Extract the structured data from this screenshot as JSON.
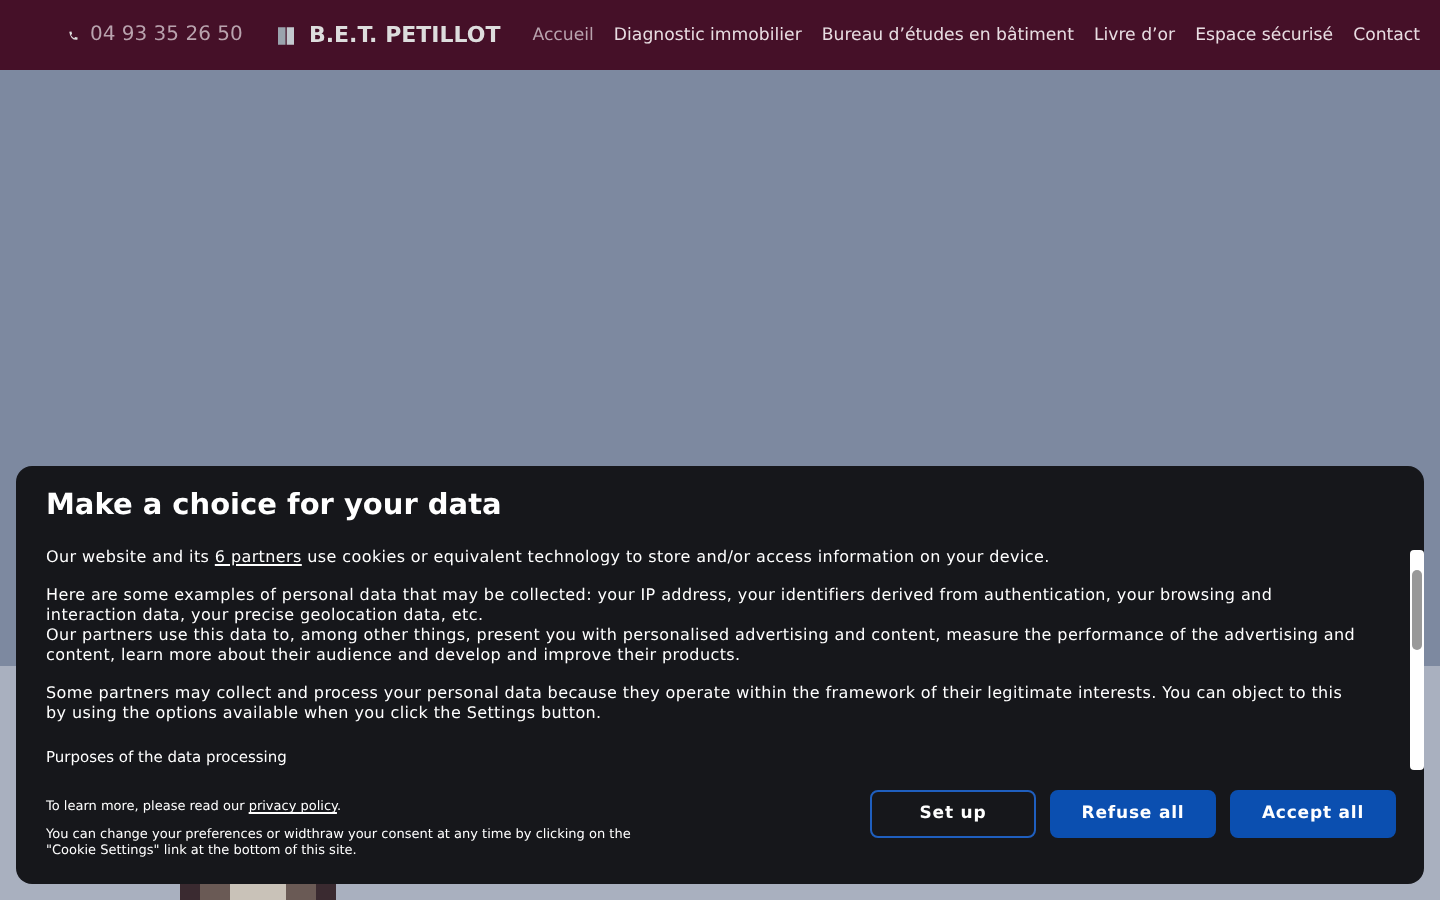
{
  "header": {
    "phone": "04 93 35 26 50",
    "brand": "B.E.T. PETILLOT",
    "nav": [
      {
        "label": "Accueil",
        "selected": true
      },
      {
        "label": "Diagnostic immobilier",
        "selected": false
      },
      {
        "label": "Bureau d’études en bâtiment",
        "selected": false
      },
      {
        "label": "Livre d’or",
        "selected": false
      },
      {
        "label": "Espace sécurisé",
        "selected": false
      },
      {
        "label": "Contact",
        "selected": false
      }
    ]
  },
  "consent": {
    "title": "Make a choice for your data",
    "intro_before": "Our website and its",
    "partners_link": "6 partners",
    "intro_after": "use cookies or equivalent technology to store and/or access information on your device.",
    "paragraphs": [
      "Here are some examples of personal data that may be collected: your IP address, your identifiers derived from authentication, your browsing and interaction data, your precise geolocation data, etc.",
      "Our partners use this data to, among other things, present you with personalised advertising and content, measure the performance of the advertising and content, learn more about their audience and develop and improve their products.",
      "Some partners may collect and process your personal data because they operate within the framework of their legitimate interests. You can object to this by using the options available when you click the Settings button."
    ],
    "purposes_heading": "Purposes of the data processing",
    "learn_before": "To learn more, please read our",
    "privacy_link": "privacy policy",
    "learn_after": ".",
    "change_note": "You can change your preferences or widthraw your consent at any time by clicking on the \"Cookie Settings\" link at the bottom of this site.",
    "buttons": [
      {
        "label": "Set up",
        "kind": "outline"
      },
      {
        "label": "Refuse all",
        "kind": "filled"
      },
      {
        "label": "Accept all",
        "kind": "filled"
      }
    ]
  }
}
